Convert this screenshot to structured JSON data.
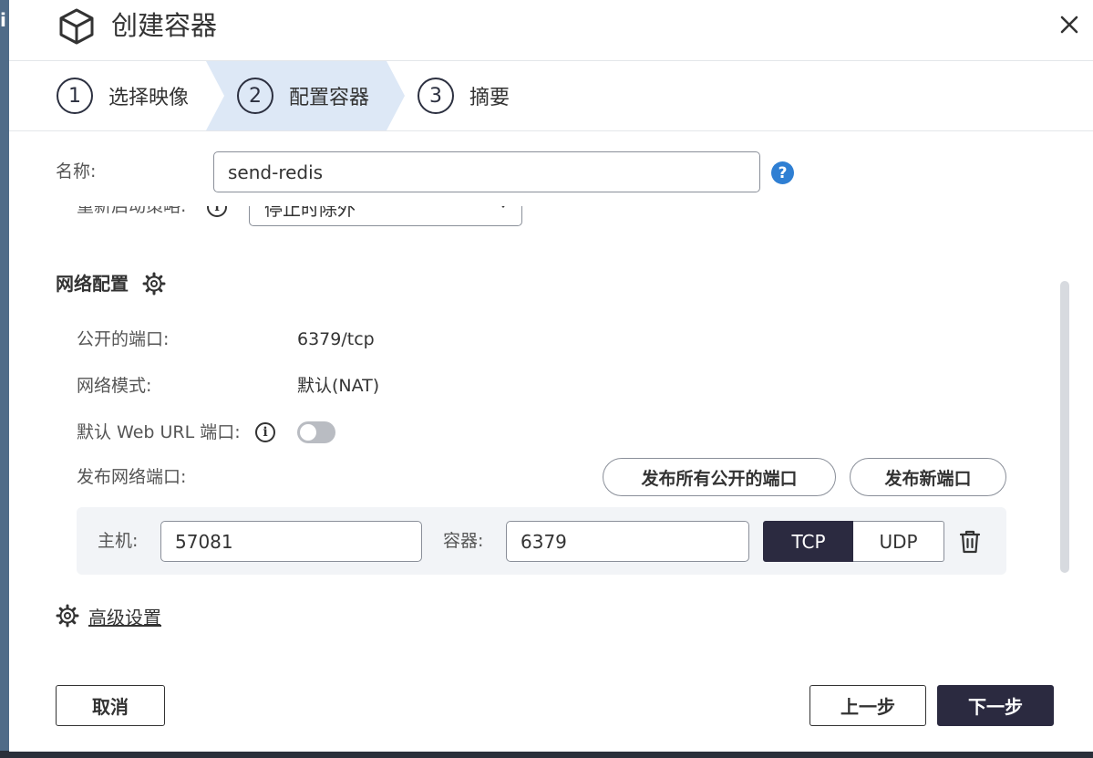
{
  "dialog": {
    "title": "创建容器",
    "icons": {
      "header": "cube-icon",
      "close": "close-icon"
    }
  },
  "steps": [
    {
      "num": "1",
      "label": "选择映像",
      "active": false
    },
    {
      "num": "2",
      "label": "配置容器",
      "active": true
    },
    {
      "num": "3",
      "label": "摘要",
      "active": false
    }
  ],
  "form": {
    "name_label": "名称:",
    "name_value": "send-redis",
    "help_glyph": "?",
    "restart_label": "重新启动策略:",
    "restart_value": "停止时除外"
  },
  "network": {
    "title": "网络配置",
    "exposed_ports_label": "公开的端口:",
    "exposed_ports_value": "6379/tcp",
    "network_mode_label": "网络模式:",
    "network_mode_value": "默认(NAT)",
    "web_url_label": "默认 Web URL 端口:",
    "web_url_enabled": false,
    "publish_label": "发布网络端口:",
    "publish_all_button": "发布所有公开的端口",
    "publish_new_button": "发布新端口",
    "port_mapping": {
      "host_label": "主机:",
      "host_value": "57081",
      "container_label": "容器:",
      "container_value": "6379",
      "protocol_options": [
        "TCP",
        "UDP"
      ],
      "selected_protocol": "TCP"
    }
  },
  "advanced": {
    "label": "高级设置"
  },
  "footer": {
    "cancel": "取消",
    "back": "上一步",
    "next": "下一步"
  },
  "colors": {
    "accent_dark": "#2b2a40",
    "step_active_bg": "#dde8f6",
    "help_blue": "#2f7fd3"
  }
}
